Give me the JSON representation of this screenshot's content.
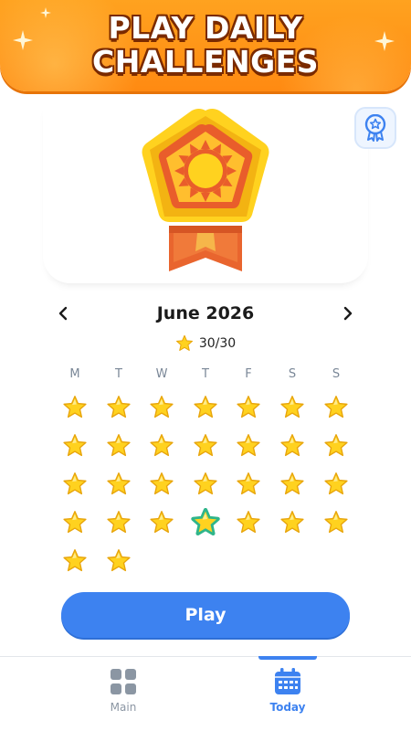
{
  "banner": {
    "line1": "PLAY DAILY",
    "line2": "CHALLENGES"
  },
  "calendar": {
    "month": "June 2026",
    "prev_icon": "chevron-left-icon",
    "next_icon": "chevron-right-icon",
    "score": "30/30",
    "weekdays": [
      "M",
      "T",
      "W",
      "T",
      "F",
      "S",
      "S"
    ],
    "days_completed": 30,
    "selected_day": 25
  },
  "play_button": {
    "label": "Play"
  },
  "nav": {
    "main_label": "Main",
    "today_label": "Today"
  },
  "colors": {
    "accent": "#3d82f0",
    "banner": "#ff8a12",
    "star": "#ffd21f"
  }
}
